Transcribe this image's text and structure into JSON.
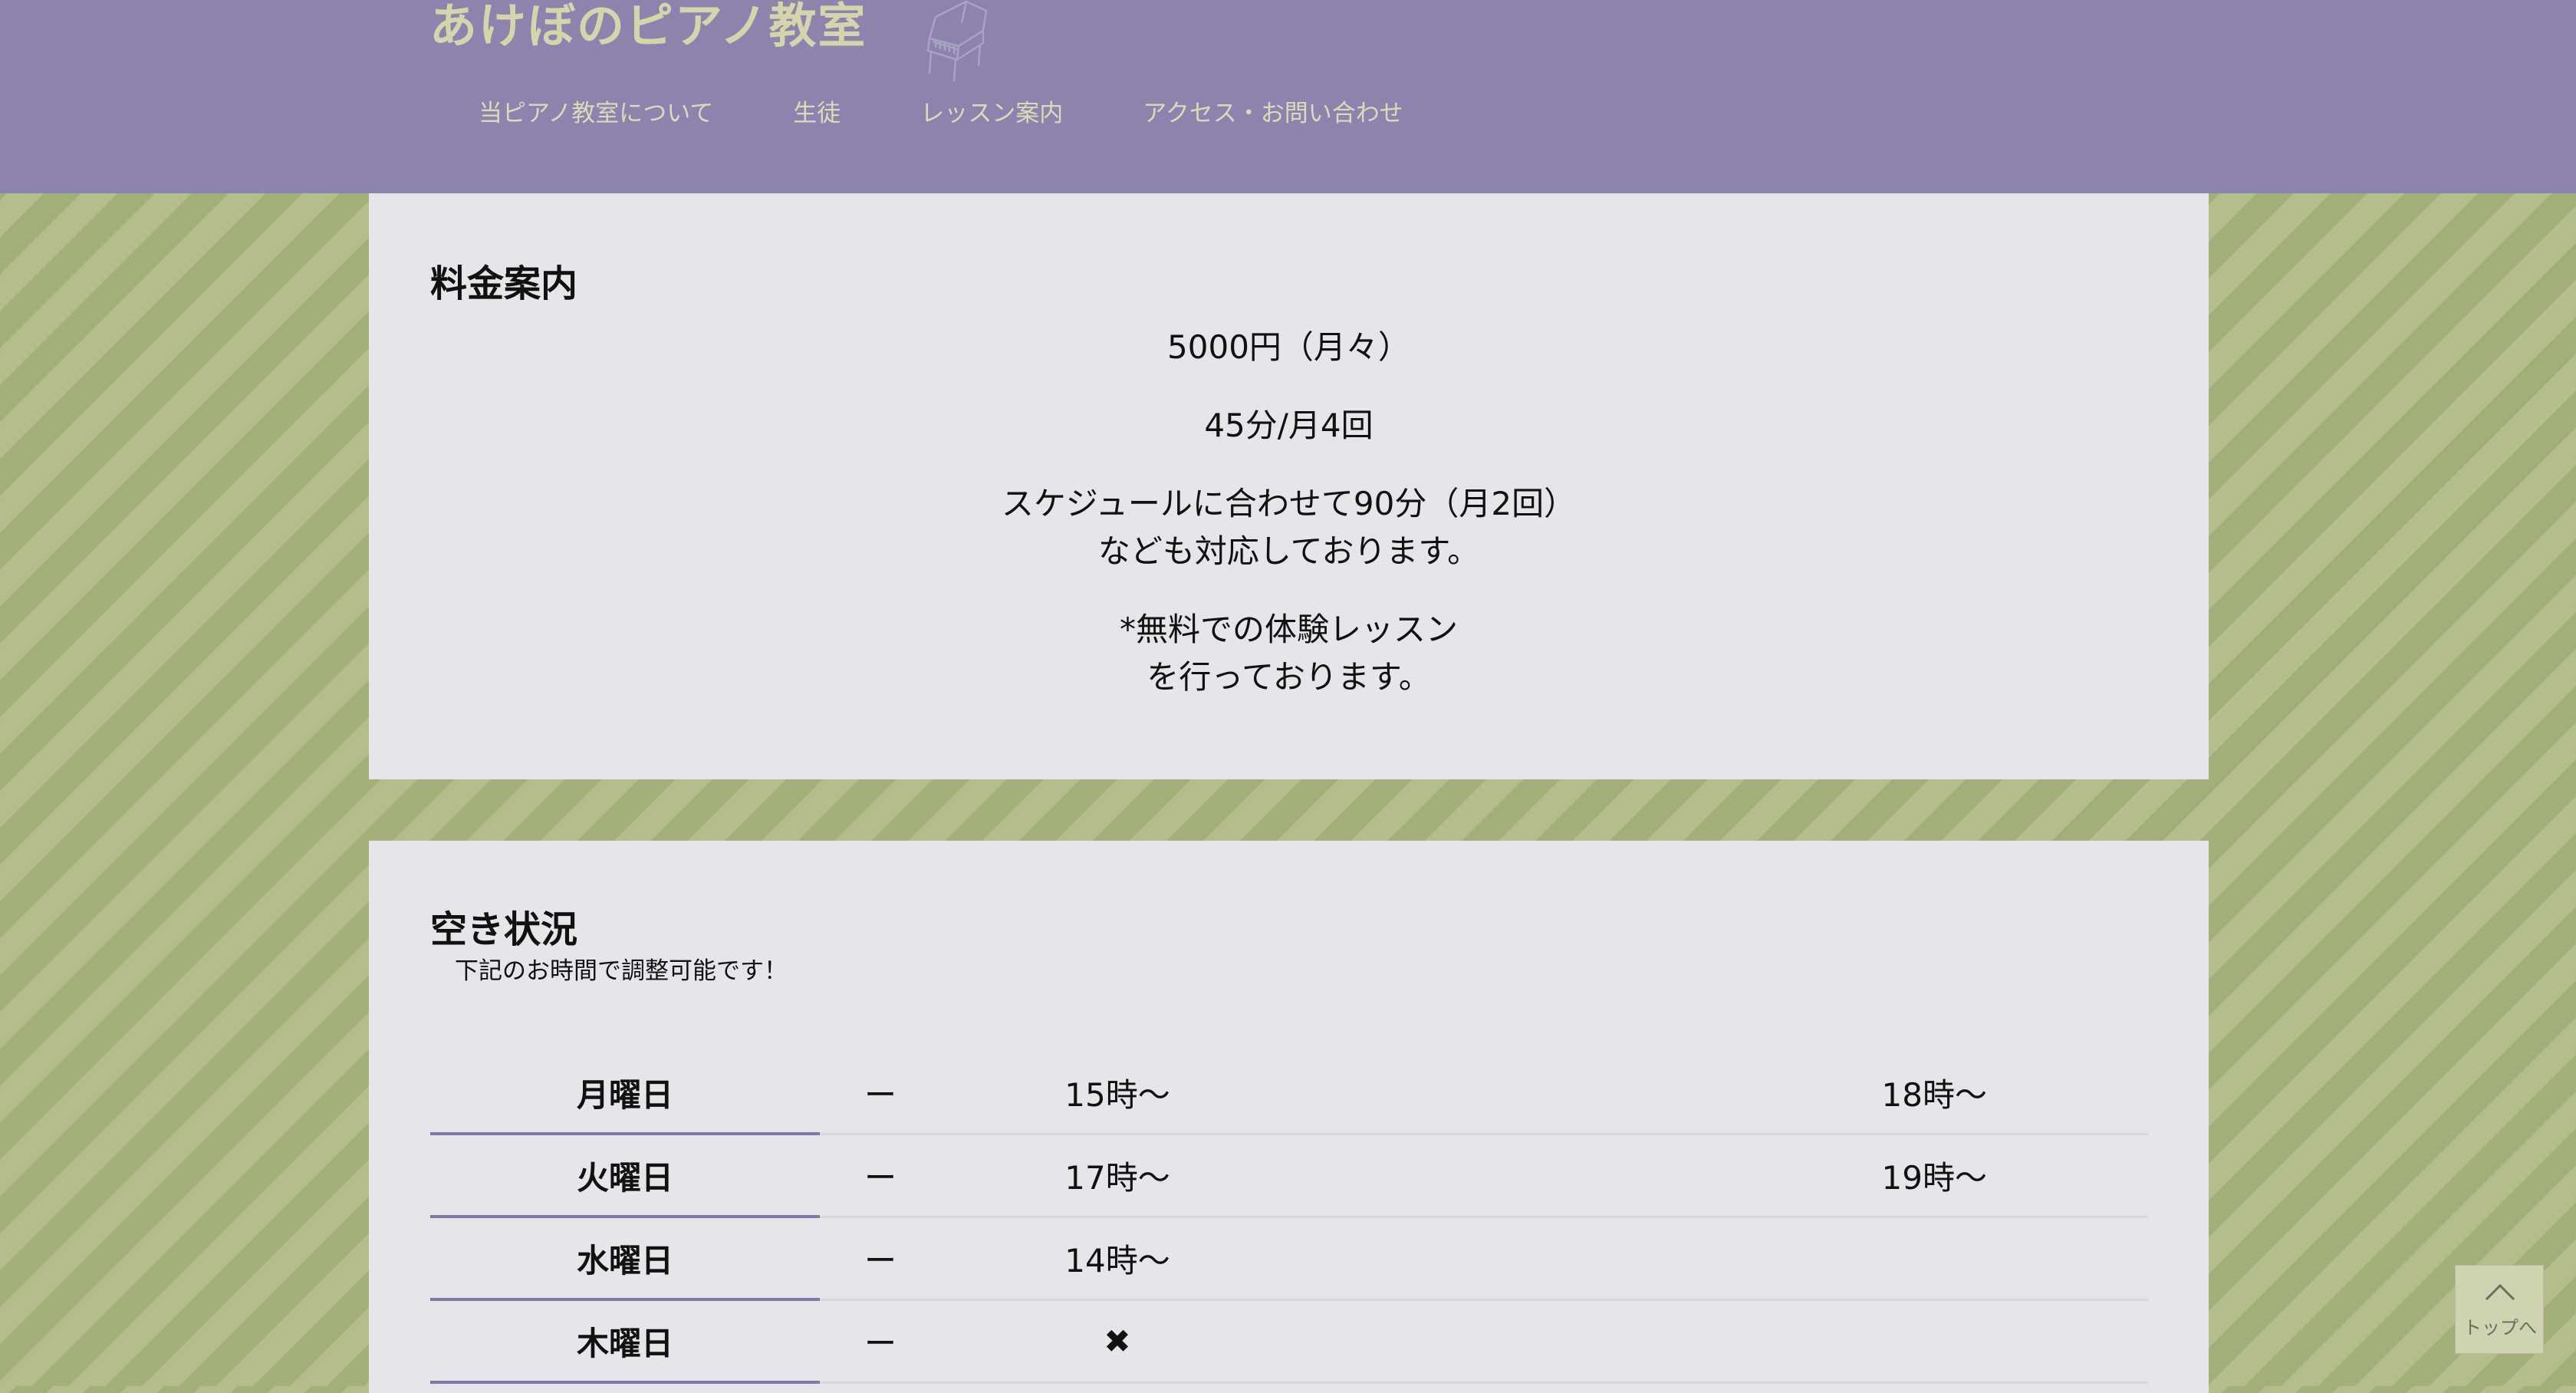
{
  "header": {
    "site_title": "あけぼのピアノ教室",
    "logo_icon": "grand-piano-icon",
    "nav": [
      {
        "label": "当ピアノ教室について"
      },
      {
        "label": "生徒"
      },
      {
        "label": "レッスン案内"
      },
      {
        "label": "アクセス・お問い合わせ"
      }
    ]
  },
  "pricing": {
    "heading": "料金案内",
    "fee": "5000円（月々）",
    "frequency": "45分/月4回",
    "flex_line1": "スケジュールに合わせて90分（月2回）",
    "flex_line2": "なども対応しております。",
    "trial_line1": "*無料での体験レッスン",
    "trial_line2": "を行っております。"
  },
  "availability": {
    "heading": "空き状況",
    "subtitle": "下記のお時間で調整可能です！",
    "rows": [
      {
        "day": "月曜日",
        "slot1": "ー",
        "slot2": "15時〜",
        "slot3": "18時〜"
      },
      {
        "day": "火曜日",
        "slot1": "ー",
        "slot2": "17時〜",
        "slot3": "19時〜"
      },
      {
        "day": "水曜日",
        "slot1": "ー",
        "slot2": "14時〜",
        "slot3": ""
      },
      {
        "day": "木曜日",
        "slot1": "ー",
        "slot2": "✖",
        "slot3": ""
      }
    ]
  },
  "back_to_top": {
    "label": "トップへ",
    "icon": "chevron-up-icon"
  },
  "colors": {
    "header_bg": "#8d83ae",
    "title_color": "#d5d4ab",
    "card_bg": "#e6e5ea",
    "stripe_dark": "#a3af78",
    "stripe_light": "#b4bd8c",
    "day_underline": "#7c79a8"
  }
}
